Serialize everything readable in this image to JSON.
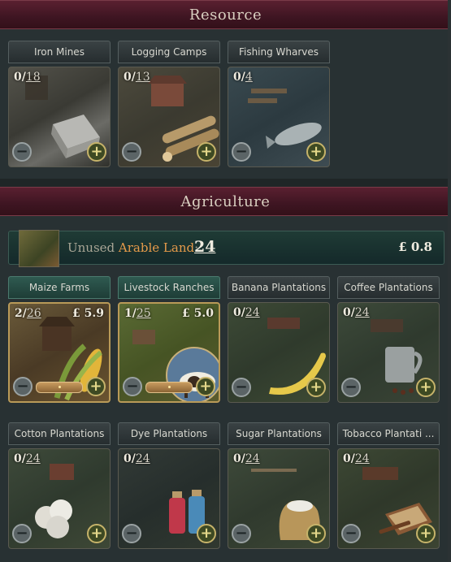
{
  "sections": {
    "resource": {
      "title": "Resource"
    },
    "agriculture": {
      "title": "Agriculture"
    }
  },
  "arable": {
    "prefix": "Unused",
    "highlight": "Arable Land",
    "colon": ":",
    "value": "24",
    "cost": "£ 0.8"
  },
  "resource_buildings": [
    {
      "name": "Iron Mines",
      "level": "0",
      "max": "18",
      "icon": "iron-ingot-icon"
    },
    {
      "name": "Logging Camps",
      "level": "0",
      "max": "13",
      "icon": "log-icon"
    },
    {
      "name": "Fishing Wharves",
      "level": "0",
      "max": "4",
      "icon": "fish-icon"
    }
  ],
  "agri_buildings": [
    {
      "name": "Maize Farms",
      "level": "2",
      "max": "26",
      "price": "£ 5.9",
      "icon": "maize-icon"
    },
    {
      "name": "Livestock Ranches",
      "level": "1",
      "max": "25",
      "price": "£ 5.0",
      "icon": "cow-icon"
    },
    {
      "name": "Banana Plantations",
      "level": "0",
      "max": "24",
      "icon": "banana-icon"
    },
    {
      "name": "Coffee Plantations",
      "level": "0",
      "max": "24",
      "icon": "coffee-icon"
    },
    {
      "name": "Cotton Plantations",
      "level": "0",
      "max": "24",
      "icon": "cotton-icon"
    },
    {
      "name": "Dye Plantations",
      "level": "0",
      "max": "24",
      "icon": "dye-bottles-icon"
    },
    {
      "name": "Sugar Plantations",
      "level": "0",
      "max": "24",
      "icon": "sugar-sack-icon"
    },
    {
      "name": "Tobacco Plantati ...",
      "level": "0",
      "max": "24",
      "icon": "cigar-box-icon"
    }
  ],
  "colors": {
    "accent": "#b99a58",
    "header": "#4a1a28",
    "active_title": "#2f5a50"
  }
}
